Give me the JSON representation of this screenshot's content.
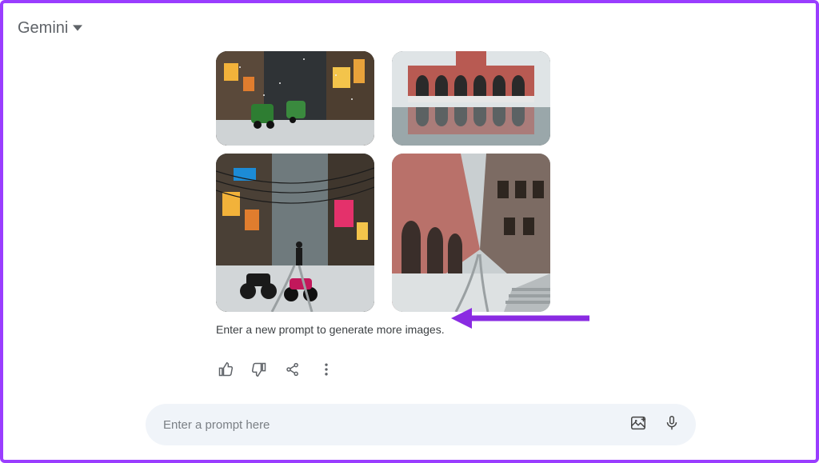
{
  "brand": {
    "name": "Gemini"
  },
  "response": {
    "hint_text": "Enter a new prompt to generate more images.",
    "images": [
      {
        "alt": "generated-image-1"
      },
      {
        "alt": "generated-image-2"
      },
      {
        "alt": "generated-image-3"
      },
      {
        "alt": "generated-image-4"
      }
    ]
  },
  "actions": {
    "like": "thumbs-up-icon",
    "dislike": "thumbs-down-icon",
    "share": "share-icon",
    "more": "more-vertical-icon"
  },
  "prompt": {
    "placeholder": "Enter a prompt here",
    "image_button": "add-image-icon",
    "mic_button": "microphone-icon"
  },
  "colors": {
    "accent_border": "#9a3dff",
    "arrow": "#8a2be2"
  }
}
